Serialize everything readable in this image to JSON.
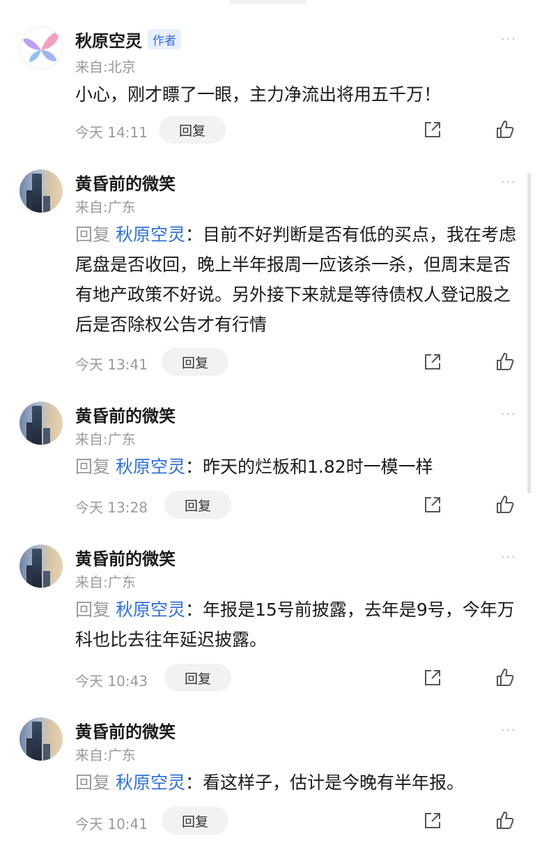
{
  "comments": [
    {
      "name": "秋原空灵",
      "badge": "作者",
      "location": "来自:北京",
      "reply_prefix": "",
      "reply_target": "",
      "reply_sep": "",
      "text": "小心，刚才瞟了一眼，主力净流出将用五千万！",
      "time": "今天 14:11",
      "reply_label": "回复",
      "more": "···"
    },
    {
      "name": "黄昏前的微笑",
      "location": "来自:广东",
      "reply_prefix": "回复",
      "reply_target": "秋原空灵",
      "reply_sep": "：",
      "text": "目前不好判断是否有低的买点，我在考虑尾盘是否收回，晚上半年报周一应该杀一杀，但周末是否有地产政策不好说。另外接下来就是等待债权人登记股之后是否除权公告才有行情",
      "time": "今天 13:41",
      "reply_label": "回复",
      "more": "···"
    },
    {
      "name": "黄昏前的微笑",
      "location": "来自:广东",
      "reply_prefix": "回复",
      "reply_target": "秋原空灵",
      "reply_sep": "：",
      "text": "昨天的烂板和1.82时一模一样",
      "time": "今天 13:28",
      "reply_label": "回复",
      "more": "···"
    },
    {
      "name": "黄昏前的微笑",
      "location": "来自:广东",
      "reply_prefix": "回复",
      "reply_target": "秋原空灵",
      "reply_sep": "：",
      "text": "年报是15号前披露，去年是9号，今年万科也比去往年延迟披露。",
      "time": "今天 10:43",
      "reply_label": "回复",
      "more": "···"
    },
    {
      "name": "黄昏前的微笑",
      "location": "来自:广东",
      "reply_prefix": "回复",
      "reply_target": "秋原空灵",
      "reply_sep": "：",
      "text": "看这样子，估计是今晚有半年报。",
      "time": "今天 10:41",
      "reply_label": "回复",
      "more": "···"
    }
  ],
  "icons": {
    "share": "share-icon",
    "like": "thumbs-up-icon",
    "more": "more-dots-icon"
  },
  "colors": {
    "link": "#2f6fe0",
    "muted": "#9a9a9a",
    "badge_bg": "#e7f0ff"
  }
}
